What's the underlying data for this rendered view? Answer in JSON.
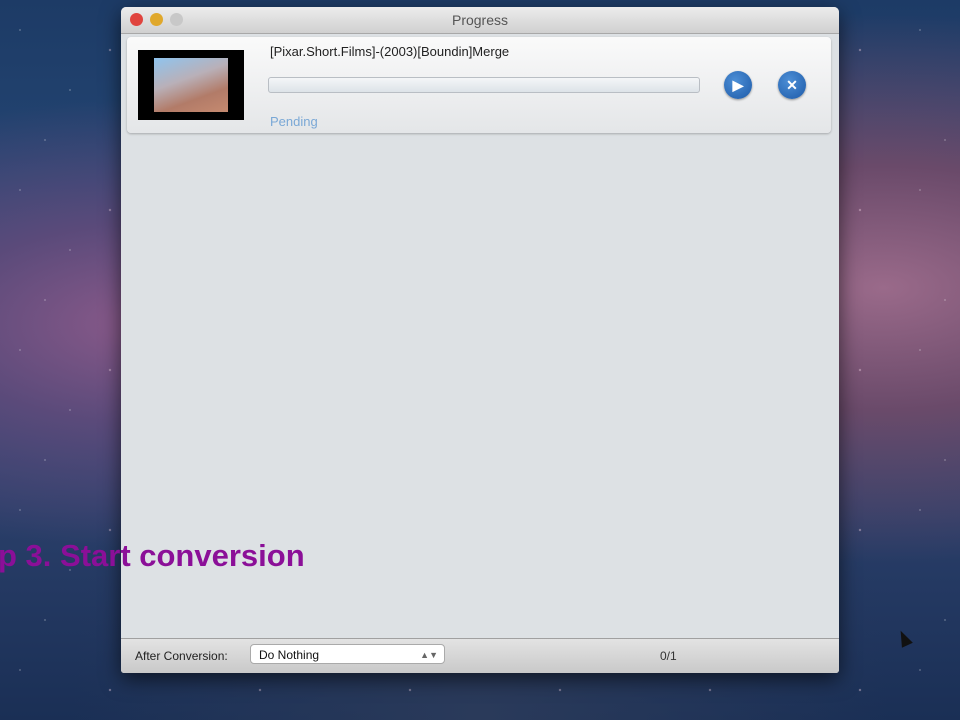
{
  "window": {
    "title": "Progress"
  },
  "item": {
    "filename": "[Pixar.Short.Films]-(2003)[Boundin]Merge",
    "status": "Pending",
    "progress": 0
  },
  "footer": {
    "after_label": "After Conversion:",
    "after_value": "Do Nothing",
    "count": "0/1"
  },
  "caption": "p 3. Start conversion",
  "colors": {
    "accent": "#1d5aa8",
    "status": "#7aa8d6",
    "caption": "#8b0f98"
  }
}
